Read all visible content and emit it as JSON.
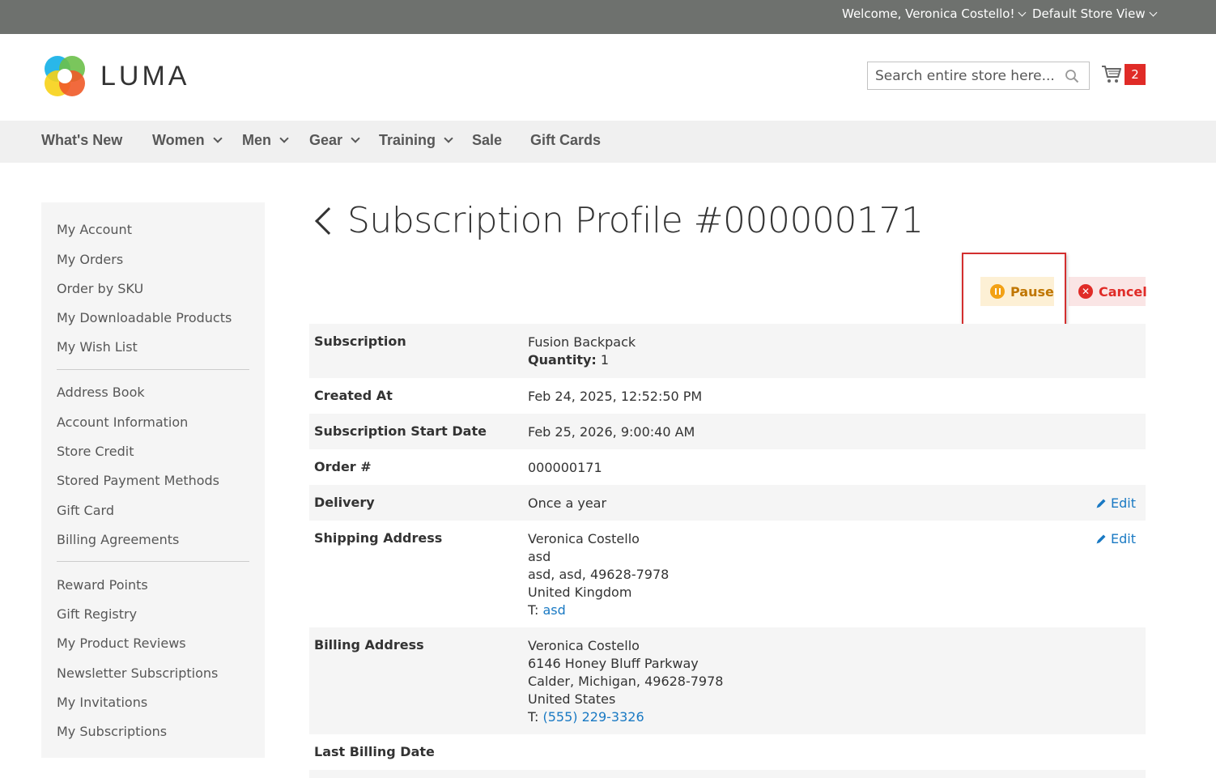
{
  "header": {
    "welcome": "Welcome, Veronica Costello!",
    "store_view": "Default Store View",
    "logo_text": "LUMA",
    "search_placeholder": "Search entire store here...",
    "cart_count": "2"
  },
  "nav": {
    "items": [
      {
        "label": "What's New",
        "has_dropdown": false
      },
      {
        "label": "Women",
        "has_dropdown": true
      },
      {
        "label": "Men",
        "has_dropdown": true
      },
      {
        "label": "Gear",
        "has_dropdown": true
      },
      {
        "label": "Training",
        "has_dropdown": true
      },
      {
        "label": "Sale",
        "has_dropdown": false
      },
      {
        "label": "Gift Cards",
        "has_dropdown": false
      }
    ]
  },
  "sidebar": {
    "items": [
      "My Account",
      "My Orders",
      "Order by SKU",
      "My Downloadable Products",
      "My Wish List",
      "Address Book",
      "Account Information",
      "Store Credit",
      "Stored Payment Methods",
      "Gift Card",
      "Billing Agreements",
      "Reward Points",
      "Gift Registry",
      "My Product Reviews",
      "Newsletter Subscriptions",
      "My Invitations",
      "My Subscriptions"
    ]
  },
  "page": {
    "title": "Subscription Profile #000000171",
    "pause_label": "Pause",
    "cancel_label": "Cancel",
    "edit_label": "Edit"
  },
  "details": {
    "subscription_label": "Subscription",
    "subscription_product": "Fusion Backpack",
    "quantity_label": "Quantity:",
    "quantity_value": "1",
    "created_at_label": "Created At",
    "created_at_value": "Feb 24, 2025, 12:52:50 PM",
    "start_date_label": "Subscription Start Date",
    "start_date_value": "Feb 25, 2026, 9:00:40 AM",
    "order_label": "Order #",
    "order_value": "000000171",
    "delivery_label": "Delivery",
    "delivery_value": "Once a year",
    "shipping_label": "Shipping Address",
    "shipping": {
      "name": "Veronica Costello",
      "line1": "asd",
      "line2": "asd, asd, 49628-7978",
      "country": "United Kingdom",
      "phone_prefix": "T:",
      "phone": "asd"
    },
    "billing_label": "Billing Address",
    "billing": {
      "name": "Veronica Costello",
      "line1": "6146 Honey Bluff Parkway",
      "line2": "Calder, Michigan, 49628-7978",
      "country": "United States",
      "phone_prefix": "T:",
      "phone": "(555) 229-3326"
    },
    "last_billing_label": "Last Billing Date"
  },
  "colors": {
    "topbar": "#6e716e",
    "link": "#1979c3",
    "pause_bg": "#fdf0d5",
    "pause_text": "#c07600",
    "cancel_bg": "#fae5e5",
    "cancel_text": "#e02b27",
    "highlight": "#d32f2f"
  }
}
